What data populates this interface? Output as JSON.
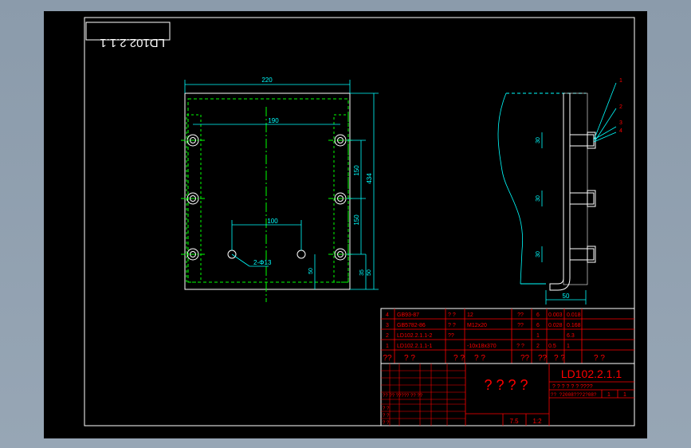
{
  "drawing": {
    "stamp": "LD102.2.1.1",
    "title_block": {
      "drawing_number": "LD102.2.1.1",
      "big_title": "? ? ? ?",
      "scale": "1:2",
      "weight": "7.5",
      "row_small": "? ?  ? ?  ? ?  ????",
      "row_code": "?? ?2008???2?08?",
      "page_a": "1",
      "page_b": "1"
    },
    "bom": [
      {
        "no": "4",
        "code": "GB93-87",
        "name": "? ?",
        "spec": "12",
        "mat": "??",
        "qty": "6",
        "w1": "0.003",
        "w2": "0.018"
      },
      {
        "no": "3",
        "code": "GB5782-86",
        "name": "? ?",
        "spec": "M12x20",
        "mat": "??",
        "qty": "6",
        "w1": "0.028",
        "w2": "0.168"
      },
      {
        "no": "2",
        "code": "LD102.2.1.1-2",
        "name": "??",
        "spec": "",
        "mat": "",
        "qty": "1",
        "w1": "",
        "w2": "6.3"
      },
      {
        "no": "1",
        "code": "LD102.2.1.1-1",
        "name": "",
        "spec": "-10x18x370",
        "mat": "? ?",
        "qty": "2",
        "w1": "0.5",
        "w2": "1"
      }
    ],
    "bom_header": [
      "??",
      "?  ?",
      "?  ?",
      "?  ?",
      "??",
      "??",
      "?  ?",
      "?  ?"
    ],
    "left_block_rows": [
      "?? ?? ????? ?? ??",
      "? ?",
      "? ?",
      "? ?"
    ],
    "dimensions": {
      "top_width": "220",
      "hole_spacing": "190",
      "v_spacing_1": "150",
      "v_spacing_2": "150",
      "total_height": "434",
      "inner_spacing": "100",
      "hole_note": "2-Φ13",
      "bottom_offset": "50",
      "side_small_1": "35",
      "side_small_2": "50",
      "side_width": "50",
      "pitch_1": "30",
      "pitch_2": "30",
      "pitch_3": "30"
    },
    "balloons": [
      "1",
      "2",
      "3",
      "4"
    ],
    "colors": {
      "outline": "#ffffff",
      "dim": "#00ffff",
      "hidden": "#00ff00",
      "table": "#ff0000",
      "text": "#ffff00"
    }
  }
}
